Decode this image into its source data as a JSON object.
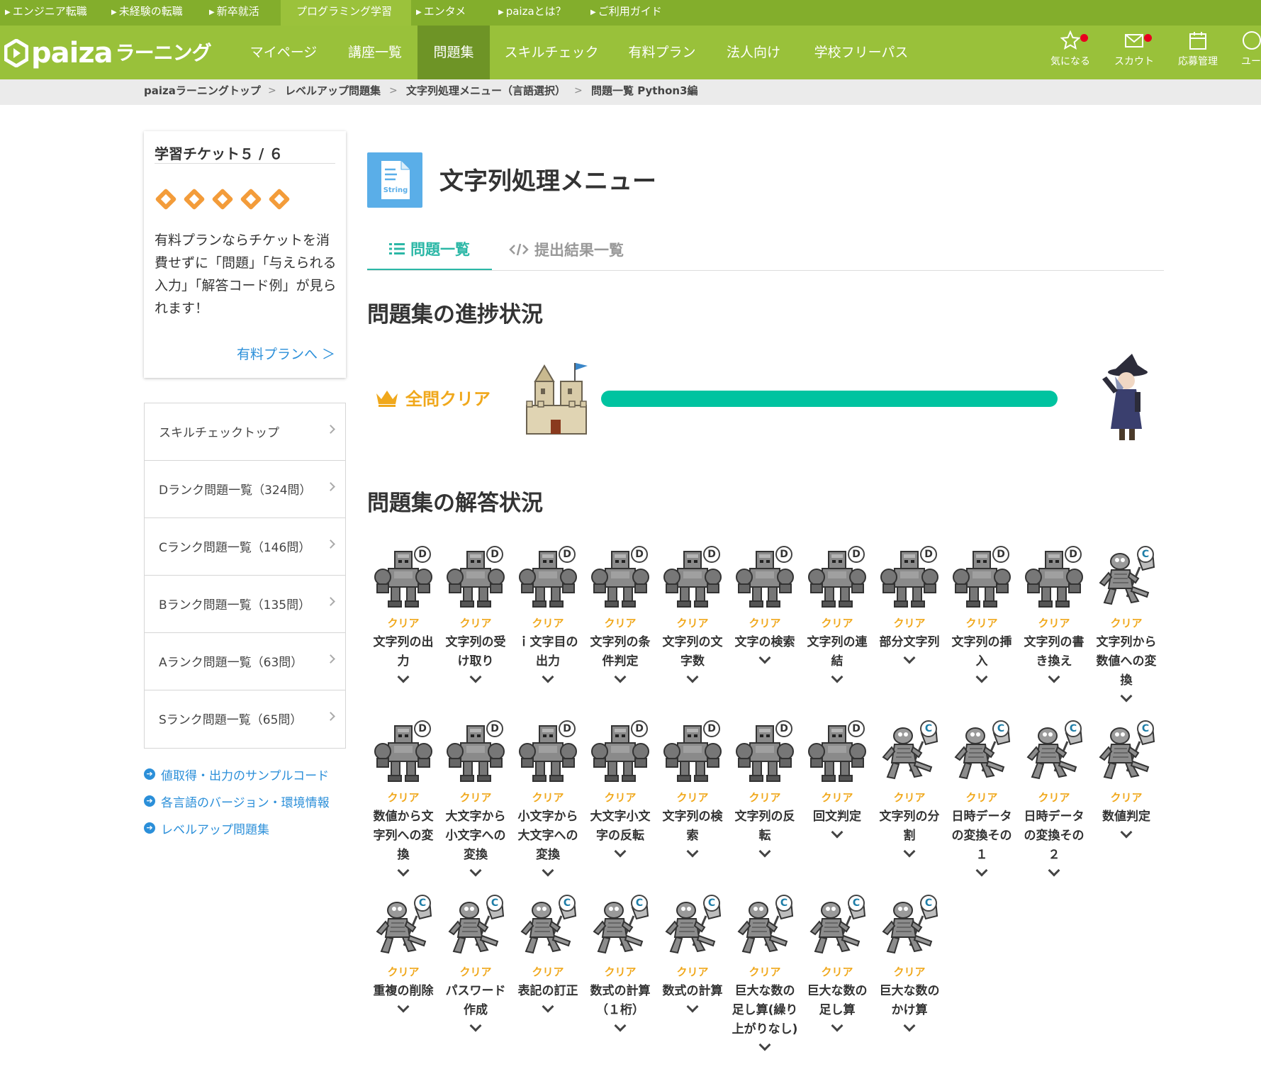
{
  "top_links": [
    "エンジニア転職",
    "未経験の転職",
    "新卒就活",
    "プログラミング学習",
    "エンタメ",
    "paizaとは？",
    "ご利用ガイド"
  ],
  "header": {
    "logo_text": "paiza",
    "logo_sub": "ラーニング",
    "nav": [
      "マイページ",
      "講座一覧",
      "問題集",
      "スキルチェック",
      "有料プラン",
      "法人向け",
      "学校フリーパス"
    ],
    "icons": [
      {
        "label": "気になる",
        "icon": "star-icon"
      },
      {
        "label": "スカウト",
        "icon": "mail-icon"
      },
      {
        "label": "応募管理",
        "icon": "calendar-icon"
      },
      {
        "label": "ユー",
        "icon": "user-icon"
      }
    ]
  },
  "breadcrumb": [
    "paizaラーニングトップ",
    "レベルアップ問題集",
    "文字列処理メニュー（言語選択）",
    "問題一覧 Python3編"
  ],
  "ticket": {
    "title": "学習チケット５ / ６",
    "count": 5,
    "text": "有料プランならチケットを消費せずに「問題」「与えられる入力」「解答コード例」が見られます！",
    "link": "有料プランへ ＞"
  },
  "side_menu": [
    "スキルチェックトップ",
    "Dランク問題一覧（324問）",
    "Cランク問題一覧（146問）",
    "Bランク問題一覧（135問）",
    "Aランク問題一覧（63問）",
    "Sランク問題一覧（65問）"
  ],
  "side_links": [
    "値取得・出力のサンプルコード",
    "各言語のバージョン・環境情報",
    "レベルアップ問題集"
  ],
  "main": {
    "icon_label": "String",
    "title": "文字列処理メニュー",
    "tabs": [
      "問題一覧",
      "提出結果一覧"
    ],
    "progress_title": "問題集の進捗状況",
    "clear_label": "全問クリア",
    "progress": 1.0,
    "answers_title": "問題集の解答状況"
  },
  "problems": [
    {
      "rank": "D",
      "status": "クリア",
      "title": "文字列の出力"
    },
    {
      "rank": "D",
      "status": "クリア",
      "title": "文字列の受け取り"
    },
    {
      "rank": "D",
      "status": "クリア",
      "title": "ｉ文字目の出力"
    },
    {
      "rank": "D",
      "status": "クリア",
      "title": "文字列の条件判定"
    },
    {
      "rank": "D",
      "status": "クリア",
      "title": "文字列の文字数"
    },
    {
      "rank": "D",
      "status": "クリア",
      "title": "文字の検索"
    },
    {
      "rank": "D",
      "status": "クリア",
      "title": "文字列の連結"
    },
    {
      "rank": "D",
      "status": "クリア",
      "title": "部分文字列"
    },
    {
      "rank": "D",
      "status": "クリア",
      "title": "文字列の挿入"
    },
    {
      "rank": "D",
      "status": "クリア",
      "title": "文字列の書き換え"
    },
    {
      "rank": "C",
      "status": "クリア",
      "title": "文字列から数値への変換"
    },
    {
      "rank": "D",
      "status": "クリア",
      "title": "数値から文字列への変換"
    },
    {
      "rank": "D",
      "status": "クリア",
      "title": "大文字から小文字への変換"
    },
    {
      "rank": "D",
      "status": "クリア",
      "title": "小文字から大文字への変換"
    },
    {
      "rank": "D",
      "status": "クリア",
      "title": "大文字小文字の反転"
    },
    {
      "rank": "D",
      "status": "クリア",
      "title": "文字列の検索"
    },
    {
      "rank": "D",
      "status": "クリア",
      "title": "文字列の反転"
    },
    {
      "rank": "D",
      "status": "クリア",
      "title": "回文判定"
    },
    {
      "rank": "C",
      "status": "クリア",
      "title": "文字列の分割"
    },
    {
      "rank": "C",
      "status": "クリア",
      "title": "日時データの変換その１"
    },
    {
      "rank": "C",
      "status": "クリア",
      "title": "日時データの変換その２"
    },
    {
      "rank": "C",
      "status": "クリア",
      "title": "数値判定"
    },
    {
      "rank": "C",
      "status": "クリア",
      "title": "重複の削除"
    },
    {
      "rank": "C",
      "status": "クリア",
      "title": "パスワード作成"
    },
    {
      "rank": "C",
      "status": "クリア",
      "title": "表記の訂正"
    },
    {
      "rank": "C",
      "status": "クリア",
      "title": "数式の計算（１桁）"
    },
    {
      "rank": "C",
      "status": "クリア",
      "title": "数式の計算"
    },
    {
      "rank": "C",
      "status": "クリア",
      "title": "巨大な数の足し算(繰り上がりなし)"
    },
    {
      "rank": "C",
      "status": "クリア",
      "title": "巨大な数の足し算"
    },
    {
      "rank": "C",
      "status": "クリア",
      "title": "巨大な数のかけ算"
    }
  ],
  "colors": {
    "brand_green": "#99c13a",
    "top_strip": "#83ae2c",
    "nav_active": "#6e9426",
    "accent_teal": "#2bb7a6",
    "progress": "#00c3a0",
    "clear_gold": "#f0a81c",
    "link_blue": "#2b8fd9"
  }
}
